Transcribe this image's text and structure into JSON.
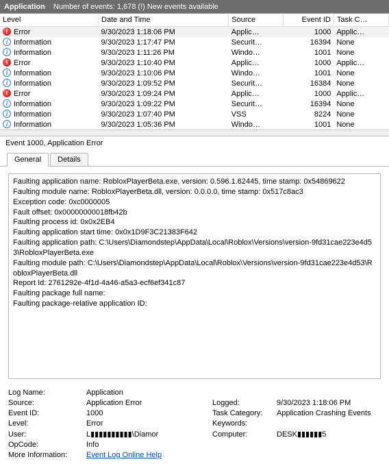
{
  "header": {
    "app_title": "Application",
    "summary": "Number of events: 1,678 (!) New events available"
  },
  "columns": {
    "level": "Level",
    "datetime": "Date and Time",
    "source": "Source",
    "event_id": "Event ID",
    "task_category": "Task C…"
  },
  "events": [
    {
      "selected": true,
      "level_kind": "error",
      "level": "Error",
      "datetime": "9/30/2023 1:18:06 PM",
      "source": "Applic…",
      "event_id": "1000",
      "task": "Applic…"
    },
    {
      "selected": false,
      "level_kind": "info",
      "level": "Information",
      "datetime": "9/30/2023 1:17:47 PM",
      "source": "Securit…",
      "event_id": "16394",
      "task": "None"
    },
    {
      "selected": false,
      "level_kind": "info",
      "level": "Information",
      "datetime": "9/30/2023 1:11:26 PM",
      "source": "Windo…",
      "event_id": "1001",
      "task": "None"
    },
    {
      "selected": false,
      "level_kind": "error",
      "level": "Error",
      "datetime": "9/30/2023 1:10:40 PM",
      "source": "Applic…",
      "event_id": "1000",
      "task": "Applic…"
    },
    {
      "selected": false,
      "level_kind": "info",
      "level": "Information",
      "datetime": "9/30/2023 1:10:06 PM",
      "source": "Windo…",
      "event_id": "1001",
      "task": "None"
    },
    {
      "selected": false,
      "level_kind": "info",
      "level": "Information",
      "datetime": "9/30/2023 1:09:52 PM",
      "source": "Securit…",
      "event_id": "16384",
      "task": "None"
    },
    {
      "selected": false,
      "level_kind": "error",
      "level": "Error",
      "datetime": "9/30/2023 1:09:24 PM",
      "source": "Applic…",
      "event_id": "1000",
      "task": "Applic…"
    },
    {
      "selected": false,
      "level_kind": "info",
      "level": "Information",
      "datetime": "9/30/2023 1:09:22 PM",
      "source": "Securit…",
      "event_id": "16394",
      "task": "None"
    },
    {
      "selected": false,
      "level_kind": "info",
      "level": "Information",
      "datetime": "9/30/2023 1:07:40 PM",
      "source": "VSS",
      "event_id": "8224",
      "task": "None"
    },
    {
      "selected": false,
      "level_kind": "info",
      "level": "Information",
      "datetime": "9/30/2023 1:05:36 PM",
      "source": "Windo…",
      "event_id": "1001",
      "task": "None"
    }
  ],
  "detail_title": "Event 1000, Application Error",
  "tabs": {
    "general": "General",
    "details": "Details"
  },
  "fault_lines": [
    "Faulting application name: RobloxPlayerBeta.exe, version: 0.596.1.62445, time stamp: 0x54869622",
    "Faulting module name: RobloxPlayerBeta.dll, version: 0.0.0.0, time stamp: 0x517c8ac3",
    "Exception code: 0xc0000005",
    "Fault offset: 0x00000000018fb42b",
    "Faulting process id: 0x0x2EB4",
    "Faulting application start time: 0x0x1D9F3C21383F642",
    "Faulting application path: C:\\Users\\Diamondstep\\AppData\\Local\\Roblox\\Versions\\version-9fd31cae223e4d53\\RobloxPlayerBeta.exe",
    "Faulting module path: C:\\Users\\Diamondstep\\AppData\\Local\\Roblox\\Versions\\version-9fd31cae223e4d53\\RobloxPlayerBeta.dll",
    "Report Id: 2761292e-4f1d-4a46-a5a3-ecf6ef341c87",
    "Faulting package full name:",
    "Faulting package-relative application ID:"
  ],
  "props": {
    "log_name_lbl": "Log Name:",
    "log_name": "Application",
    "source_lbl": "Source:",
    "source": "Application Error",
    "logged_lbl": "Logged:",
    "logged": "9/30/2023 1:18:06 PM",
    "event_id_lbl": "Event ID:",
    "event_id": "1000",
    "task_cat_lbl": "Task Category:",
    "task_category": "Application Crashing Events",
    "level_lbl": "Level:",
    "level": "Error",
    "keywords_lbl": "Keywords:",
    "keywords": "",
    "user_lbl": "User:",
    "user": "L▮▮▮▮▮▮▮▮▮▮\\Diamor",
    "computer_lbl": "Computer:",
    "computer": "DESK▮▮▮▮▮▮5",
    "opcode_lbl": "OpCode:",
    "opcode": "Info",
    "more_info_lbl": "More Information:",
    "more_info_link": "Event Log Online Help"
  }
}
